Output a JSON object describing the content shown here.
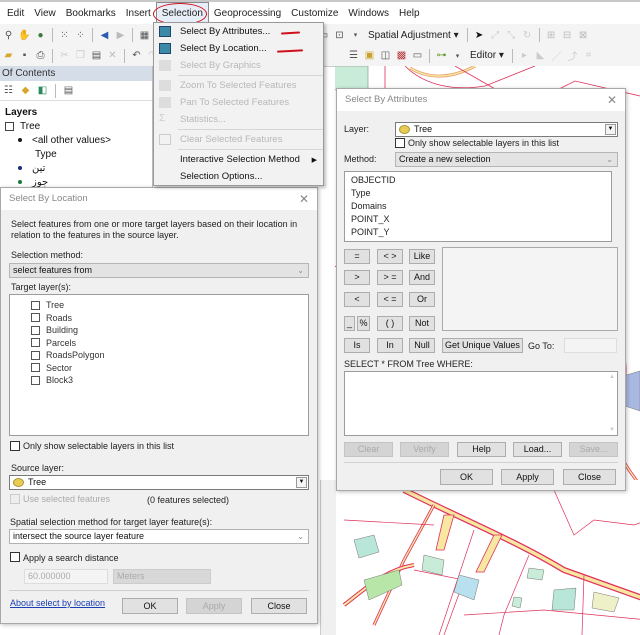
{
  "menubar": {
    "items": [
      "Edit",
      "View",
      "Bookmarks",
      "Insert",
      "Selection",
      "Geoprocessing",
      "Customize",
      "Windows",
      "Help"
    ],
    "active": "Selection"
  },
  "toolbars": {
    "spatial_adjustment_label": "Spatial Adjustment ▾",
    "editor_label": "Editor ▾"
  },
  "toc": {
    "header": "Of Contents",
    "layers_label": "Layers",
    "layer_name": "Tree",
    "legend": [
      {
        "label": "<all other values>",
        "color": "#1a1a1a"
      },
      {
        "label": "Type",
        "color": null
      },
      {
        "label": "تین",
        "color": "#1a2a7a"
      },
      {
        "label": "جوز",
        "color": "#1a7a3a"
      }
    ]
  },
  "selection_menu": {
    "items": [
      {
        "label": "Select By Attributes...",
        "enabled": true,
        "icon": "select-by-attributes-icon"
      },
      {
        "label": "Select By Location...",
        "enabled": true,
        "icon": "select-by-location-icon"
      },
      {
        "label": "Select By Graphics",
        "enabled": false,
        "icon": "select-by-graphics-icon"
      },
      {
        "separator": true
      },
      {
        "label": "Zoom To Selected Features",
        "enabled": false,
        "icon": "zoom-to-selected-icon"
      },
      {
        "label": "Pan To Selected Features",
        "enabled": false,
        "icon": "pan-to-selected-icon"
      },
      {
        "label": "Statistics...",
        "enabled": false,
        "icon": "statistics-icon"
      },
      {
        "separator": true
      },
      {
        "label": "Clear Selected Features",
        "enabled": false,
        "icon": "clear-selection-icon"
      },
      {
        "separator": true
      },
      {
        "label": "Interactive Selection Method",
        "enabled": true,
        "submenu": true
      },
      {
        "label": "Selection Options...",
        "enabled": true
      }
    ]
  },
  "select_by_location": {
    "title": "Select By Location",
    "description": "Select features from one or more target layers based on their location in relation to the features in the source layer.",
    "selection_method_label": "Selection method:",
    "selection_method_value": "select features from",
    "target_layers_label": "Target layer(s):",
    "target_layers": [
      "Tree",
      "Roads",
      "Building",
      "Parcels",
      "RoadsPolygon",
      "Sector",
      "Block3"
    ],
    "only_selectable_label": "Only show selectable layers in this list",
    "source_layer_label": "Source layer:",
    "source_layer_value": "Tree",
    "use_selected_label": "Use selected features",
    "features_selected": "(0 features selected)",
    "spatial_method_label": "Spatial selection method for target layer feature(s):",
    "spatial_method_value": "intersect the source layer feature",
    "search_distance_label": "Apply a search distance",
    "search_distance_value": "60.000000",
    "search_distance_units": "Meters",
    "about_link": "About select by location",
    "ok": "OK",
    "apply": "Apply",
    "close": "Close"
  },
  "select_by_attributes": {
    "title": "Select By Attributes",
    "layer_label": "Layer:",
    "layer_value": "Tree",
    "only_selectable_label": "Only show selectable layers in this list",
    "method_label": "Method:",
    "method_value": "Create a new selection",
    "fields": [
      "OBJECTID",
      "Type",
      "Domains",
      "POINT_X",
      "POINT_Y"
    ],
    "operators": [
      [
        "=",
        "< >",
        "Like"
      ],
      [
        ">",
        "> =",
        "And"
      ],
      [
        "<",
        "< =",
        "Or"
      ],
      [
        "_",
        "%",
        "( )",
        "Not"
      ],
      [
        "Is",
        "In",
        "Null"
      ]
    ],
    "get_unique_values": "Get Unique Values",
    "go_to_label": "Go To:",
    "go_to_value": "",
    "query_prefix": "SELECT * FROM Tree WHERE:",
    "query_value": "",
    "clear": "Clear",
    "verify": "Verify",
    "help": "Help",
    "load": "Load...",
    "save": "Save...",
    "ok": "OK",
    "apply": "Apply",
    "close": "Close"
  },
  "colors": {
    "annotation_red": "#d0101c",
    "parcel_line": "#e0305a",
    "road_fill": "#f7e7a0",
    "building_fill": "#b8e6d8",
    "link_blue": "#1a3fb3"
  }
}
